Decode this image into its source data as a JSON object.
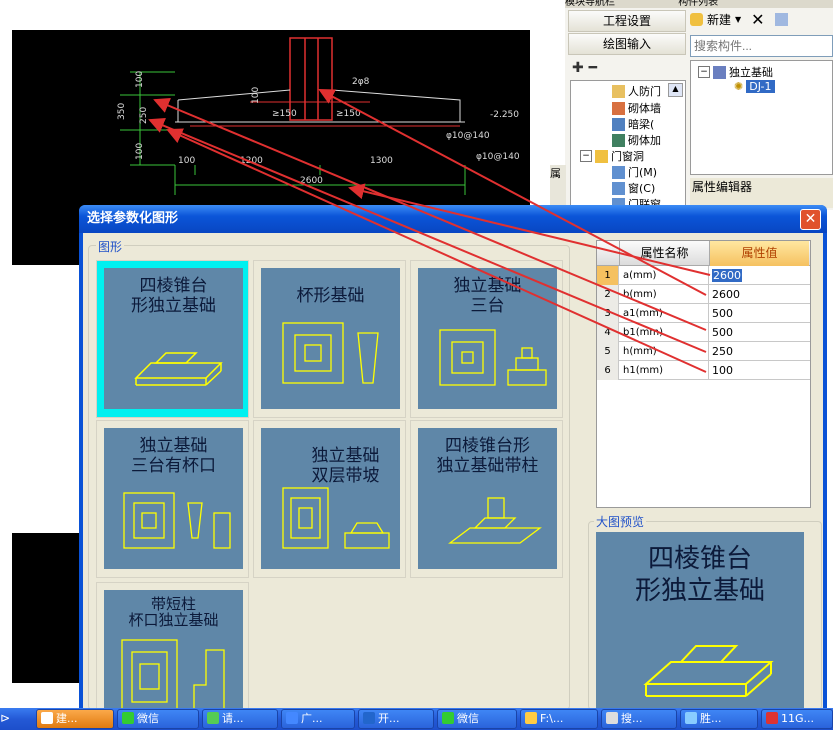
{
  "nav": {
    "top_label_left": "模块导航栏",
    "top_label_right": "构件列表",
    "project_settings": "工程设置",
    "drawing_input": "绘图输入",
    "tree_items": [
      "人防门",
      "砌体墙",
      "暗梁(",
      "砌体加",
      "门窗洞",
      "门(M)",
      "窗(C)",
      "门联窗"
    ],
    "side_label": "属"
  },
  "component_list": {
    "new_label": "新建",
    "search_placeholder": "搜索构件...",
    "tree_root": "独立基础",
    "tree_child": "DJ-1"
  },
  "property_editor": {
    "title": "属性编辑器",
    "partial_col": "属性名称"
  },
  "cad": {
    "dims_left": [
      "100",
      "350",
      "250",
      "100"
    ],
    "dims_bottom": [
      "100",
      "1200",
      "1300",
      "2600"
    ],
    "labels": [
      "2φ8",
      "100",
      "≥150",
      "≥150",
      "-2.250",
      "φ10@140",
      "φ10@140"
    ]
  },
  "dialog": {
    "title": "选择参数化图形",
    "close_label": "✕",
    "group_shapes": "图形",
    "group_preview": "大图预览",
    "shapes": [
      {
        "name_line1": "四棱锥台",
        "name_line2": "形独立基础"
      },
      {
        "name_line1": "杯形基础",
        "name_line2": ""
      },
      {
        "name_line1": "独立基础",
        "name_line2": "三台"
      },
      {
        "name_line1": "独立基础",
        "name_line2": "三台有杯口"
      },
      {
        "name_line1": "独立基础",
        "name_line2": "双层带坡"
      },
      {
        "name_line1": "四棱锥台形",
        "name_line2": "独立基础带柱"
      },
      {
        "name_line1": "带短柱",
        "name_line2": "杯口独立基础"
      }
    ],
    "selected_index": 0,
    "table": {
      "col_name": "属性名称",
      "col_value": "属性值",
      "rows": [
        {
          "n": "1",
          "name": "a(mm)",
          "value": "2600"
        },
        {
          "n": "2",
          "name": "b(mm)",
          "value": "2600"
        },
        {
          "n": "3",
          "name": "a1(mm)",
          "value": "500"
        },
        {
          "n": "4",
          "name": "b1(mm)",
          "value": "500"
        },
        {
          "n": "5",
          "name": "h(mm)",
          "value": "250"
        },
        {
          "n": "6",
          "name": "h1(mm)",
          "value": "100"
        }
      ]
    },
    "preview_line1": "四棱锥台",
    "preview_line2": "形独立基础"
  },
  "taskbar": {
    "items": [
      "建...",
      "微信",
      "请...",
      "广...",
      "开...",
      "微信",
      "F:\\...",
      "搜...",
      "胜...",
      "11G..."
    ]
  },
  "colors": {
    "dialog_blue": "#0a52d6",
    "shape_bg": "#5f87a8",
    "selected": "#00f0f0",
    "annotation_red": "#e03030",
    "cad_bg": "#000000"
  }
}
